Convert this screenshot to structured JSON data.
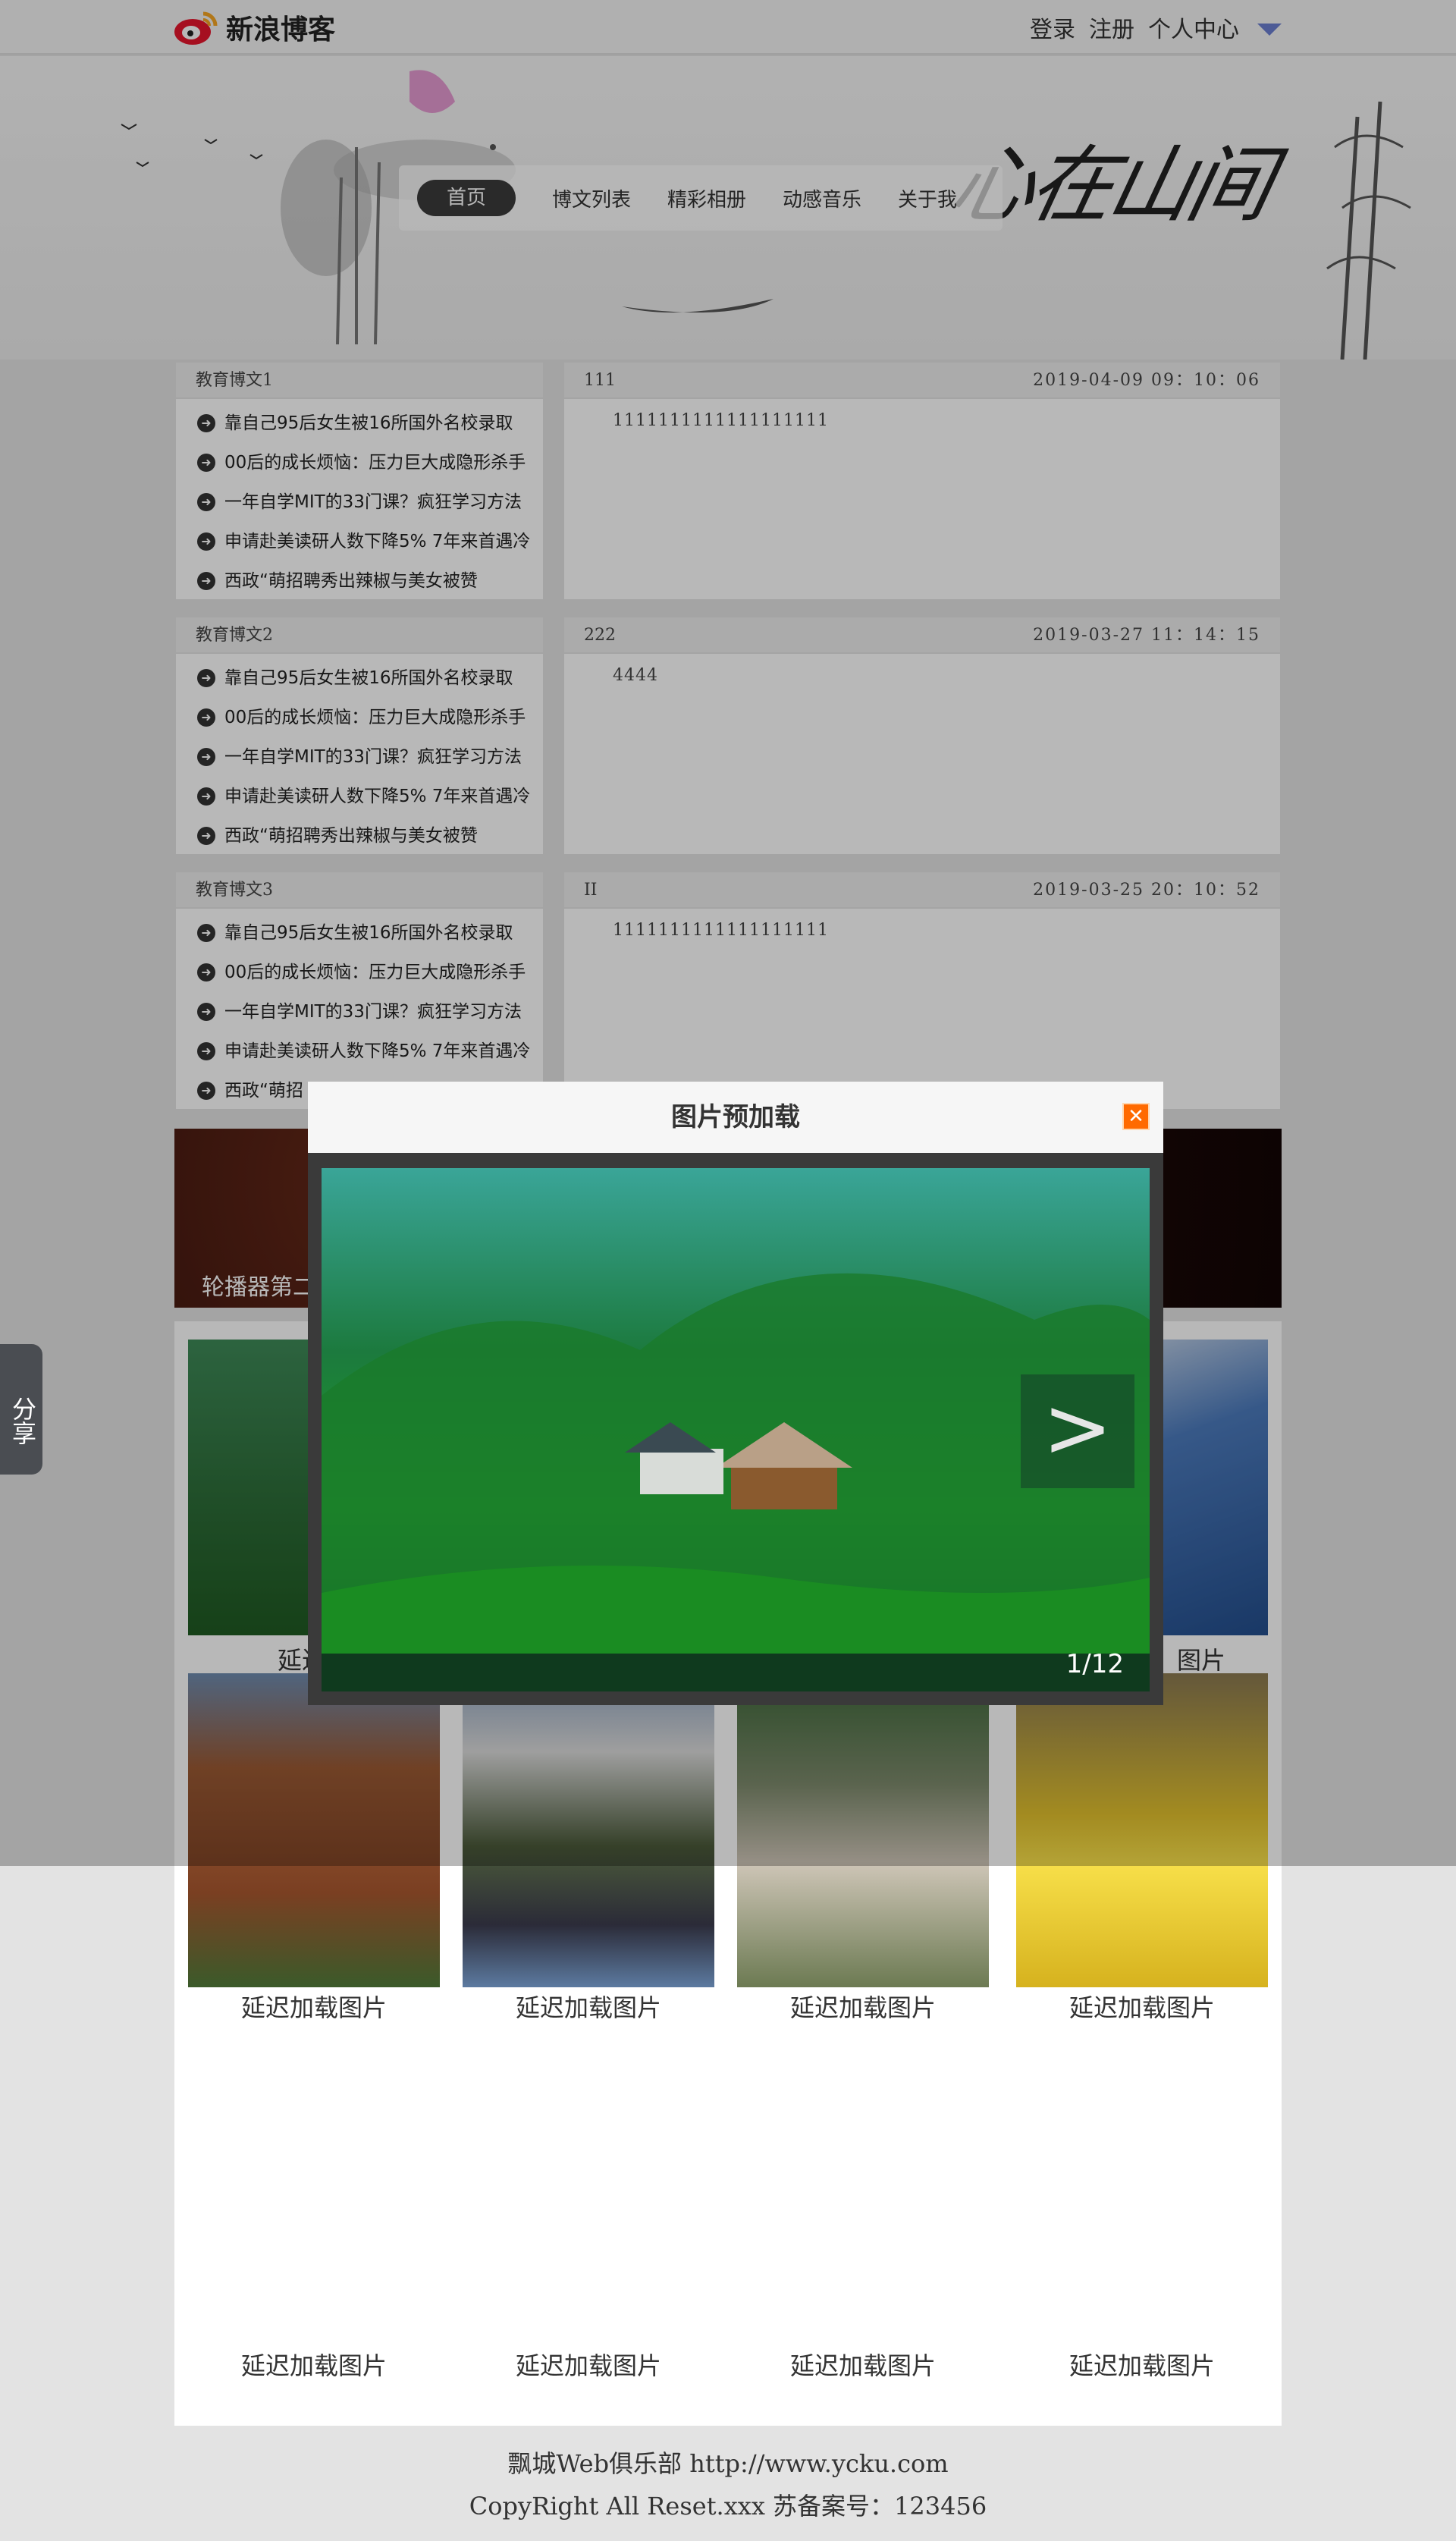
{
  "topbar": {
    "logo_text": "新浪博客",
    "links": [
      "登录",
      "注册",
      "个人中心"
    ]
  },
  "header": {
    "calligraphy": "心在山间",
    "nav": [
      "首页",
      "博文列表",
      "精彩相册",
      "动感音乐",
      "关于我"
    ]
  },
  "rows": [
    {
      "left_title": "教育博文1",
      "news": [
        "靠自己95后女生被16所国外名校录取",
        "00后的成长烦恼：压力巨大成隐形杀手",
        "一年自学MIT的33门课？疯狂学习方法",
        "申请赴美读研人数下降5% 7年来首遇冷",
        "西政“萌招聘秀出辣椒与美女被赞"
      ],
      "right_title": "111",
      "date": "2019-04-09 09：10：06",
      "body": "1111111111111111111"
    },
    {
      "left_title": "教育博文2",
      "news": [
        "靠自己95后女生被16所国外名校录取",
        "00后的成长烦恼：压力巨大成隐形杀手",
        "一年自学MIT的33门课？疯狂学习方法",
        "申请赴美读研人数下降5% 7年来首遇冷",
        "西政“萌招聘秀出辣椒与美女被赞"
      ],
      "right_title": "222",
      "date": "2019-03-27 11：14：15",
      "body": "4444"
    },
    {
      "left_title": "教育博文3",
      "news": [
        "靠自己95后女生被16所国外名校录取",
        "00后的成长烦恼：压力巨大成隐形杀手",
        "一年自学MIT的33门课？疯狂学习方法",
        "申请赴美读研人数下降5% 7年来首遇冷",
        "西政“萌招"
      ],
      "right_title": "II",
      "date": "2019-03-25 20：10：52",
      "body": "1111111111111111111"
    }
  ],
  "carousel": {
    "caption": "轮播器第二"
  },
  "gallery": {
    "row2_captions": [
      "延迟加载图片",
      "延迟加载图片",
      "延迟加载图片",
      "延迟加载图片"
    ],
    "row3_captions": [
      "延迟加载图片",
      "延迟加载图片",
      "延迟加载图片",
      "延迟加载图片"
    ],
    "row1_captions": [
      "延迟加",
      "图片"
    ]
  },
  "footer": {
    "line1": "飘城Web俱乐部 http://www.ycku.com",
    "line2": "CopyRight All Reset.xxx 苏备案号：123456"
  },
  "share": {
    "label": "分享"
  },
  "modal": {
    "title": "图片预加载",
    "counter": "1/12",
    "next_symbol": ">"
  },
  "colors": {
    "accent": "#ff6a00",
    "caret": "#6b7fd0",
    "nav_active": "#3b3b3b"
  }
}
